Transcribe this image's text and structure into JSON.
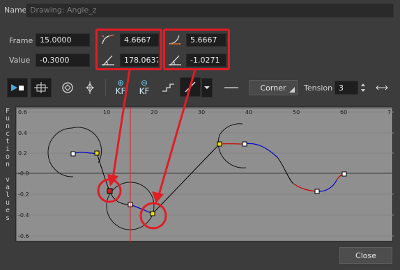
{
  "name_label": "Name",
  "name_value": "Drawing: Angle_z",
  "frame": {
    "label": "Frame",
    "value": "15.0000"
  },
  "value": {
    "label": "Value",
    "value": "-0.3000"
  },
  "left_handle": {
    "frame": "4.6667",
    "angle": "178.0637"
  },
  "right_handle": {
    "frame": "5.6667",
    "angle": "-1.0271"
  },
  "toolbar": {
    "kf_add": "KF",
    "kf_remove": "KF",
    "interpolation": "Corner",
    "tension_label": "Tension",
    "tension_value": "3"
  },
  "y_axis_label": "Function values",
  "x_ticks": [
    "10",
    "20",
    "30",
    "40",
    "50",
    "60",
    "7"
  ],
  "y_ticks": [
    "0.6",
    "0.4",
    "0.2",
    "-0.0",
    "-0.2",
    "-0.4",
    "-0.6"
  ],
  "close_label": "Close",
  "colors": {
    "annotation": "#e11d25",
    "curve_ease_in": "#ff0000",
    "curve_ease_out": "#0000cc",
    "keyframe": "#ffffff",
    "selected_keyframe": "#cc2222",
    "handle": "#f0e000"
  }
}
